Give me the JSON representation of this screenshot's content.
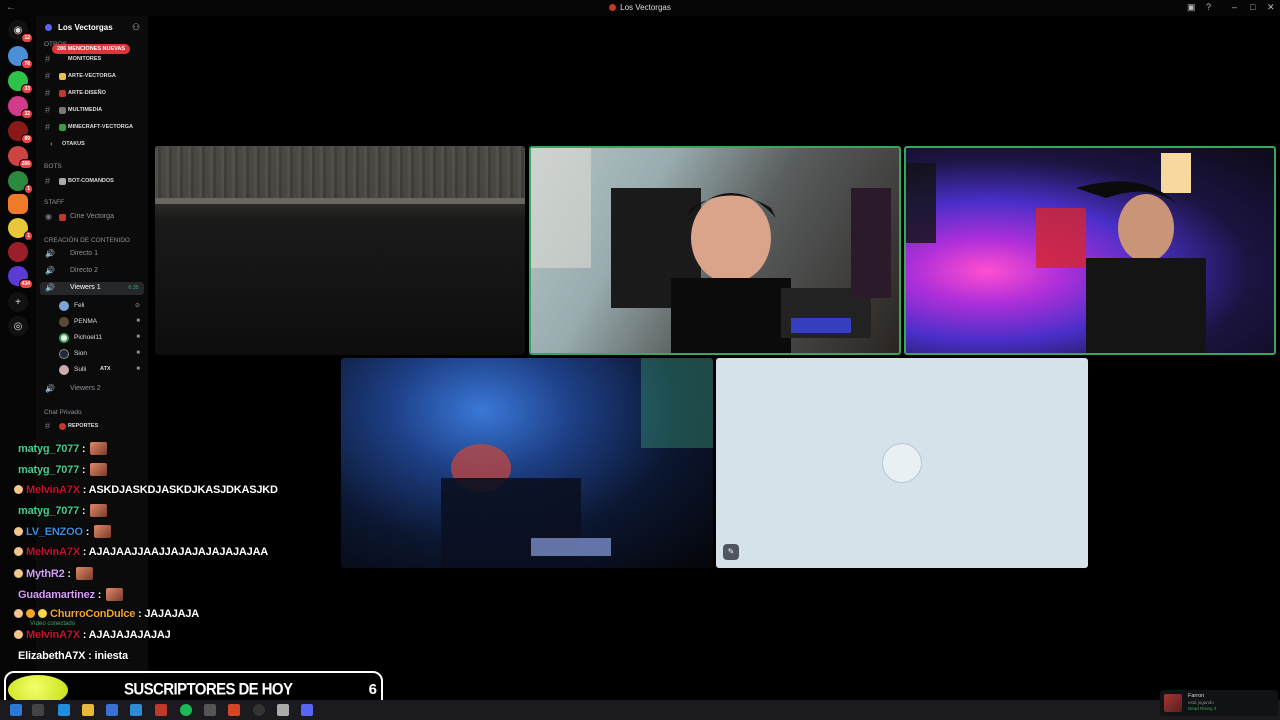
{
  "window": {
    "title": "Los Vectorgas"
  },
  "server_rail": {
    "badges": [
      "12",
      "78",
      "33",
      "32",
      "89",
      "286",
      "1",
      "1",
      "434"
    ]
  },
  "sidebar": {
    "server_name": "Los Vectorgas",
    "mentions_pill": "286 MENCIONES NUEVAS",
    "categories": {
      "otros": "OTROS",
      "bots": "BOTS",
      "staff": "STAFF",
      "creacion": "CREACIÓN DE CONTENIDO",
      "chat_privado": "Chat Privado"
    },
    "channels": {
      "monitores": "MONITORES",
      "arte_vectorga": "ARTE-VECTORGA",
      "arte_diseno": "ARTE-DISEÑO",
      "multimedia": "MULTIMEDIA",
      "minecraft": "MINECRAFT-VECTORGA",
      "otakus": "OTAKUS",
      "bot_comandos": "BOT-COMANDOS",
      "cine_vectorga": "Cine Vectorga",
      "directo_1": "Directo 1",
      "directo_2": "Directo 2",
      "viewers_1": "Viewers 1",
      "viewers_1_time": "6:35",
      "viewers_2": "Viewers 2",
      "reportes": "REPORTES"
    },
    "voice_users": [
      "Feli",
      "PENMA",
      "Pichoel11",
      "Sion",
      "Sulli"
    ],
    "voice_user_tag": "ATX",
    "video_status": "Vídeo conectado"
  },
  "chat": [
    {
      "user": "matyg_7077",
      "user_color": "#3fcf8e",
      "text": ""
    },
    {
      "user": "matyg_7077",
      "user_color": "#3fcf8e",
      "text": ""
    },
    {
      "user": "MelvinA7X",
      "user_color": "#c8102e",
      "text": "ASKDJASKDJASKDJKASJDKASJKD"
    },
    {
      "user": "matyg_7077",
      "user_color": "#3fcf8e",
      "text": ""
    },
    {
      "user": "LV_ENZOO",
      "user_color": "#3a8cde",
      "text": ""
    },
    {
      "user": "MelvinA7X",
      "user_color": "#c8102e",
      "text": "AJAJAAJJAAJJAJAJAJAJAJAJAA"
    },
    {
      "user": "MythR2",
      "user_color": "#d89cff",
      "text": ""
    },
    {
      "user": "Guadamartinez",
      "user_color": "#d89cff",
      "text": ""
    },
    {
      "user": "ChurroConDulce",
      "user_color": "#f5a623",
      "text": "JAJAJAJA"
    },
    {
      "user": "MelvinA7X",
      "user_color": "#c8102e",
      "text": "AJAJAJAJAJAJ"
    },
    {
      "user": "ElizabethA7X",
      "user_color": "#ffffff",
      "text": "iniesta"
    }
  ],
  "sub_bar": {
    "label": "SUSCRIPTORES DE HOY",
    "count": "6"
  },
  "now_playing": {
    "user": "Farron",
    "status": "está jugando",
    "game": "Dead Rising 3"
  },
  "colors": {
    "speaking": "#3ba55c",
    "mention": "#da373c",
    "blurple": "#5865f2"
  }
}
